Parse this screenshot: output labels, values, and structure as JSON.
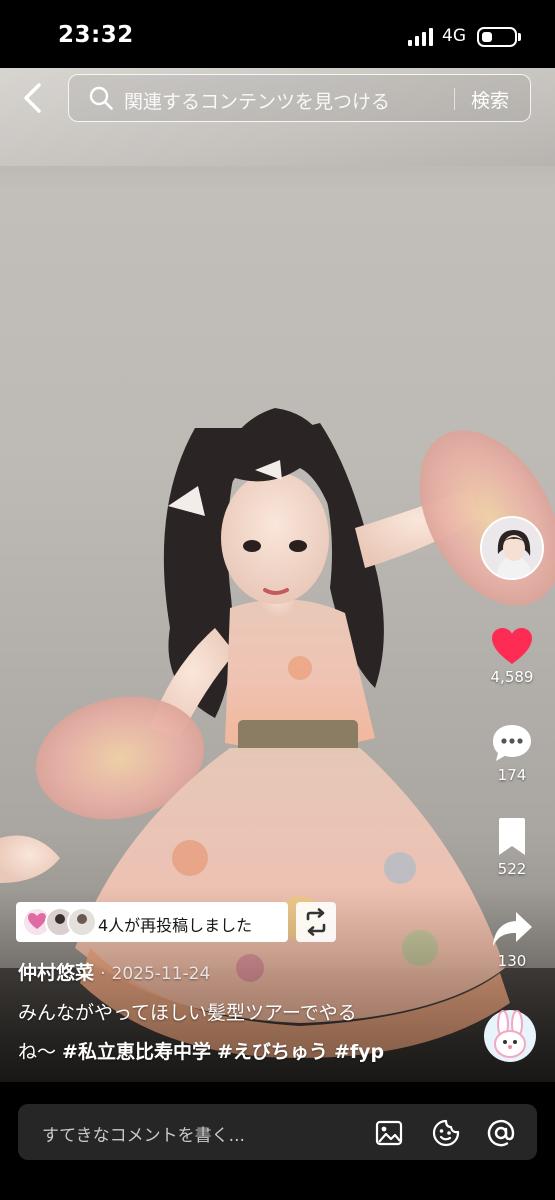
{
  "status_bar": {
    "time": "23:32",
    "network": "4G"
  },
  "search": {
    "placeholder": "関連するコンテンツを見つける",
    "button_label": "検索"
  },
  "actions": {
    "likes": "4,589",
    "comments": "174",
    "saves": "522",
    "shares": "130",
    "colors": {
      "like": "#fe2c55"
    }
  },
  "repost": {
    "text": "4人が再投稿しました"
  },
  "post": {
    "author": "仲村悠菜",
    "date_separator": "·",
    "date": "2025-11-24",
    "caption_line1": "みんながやってほしい髪型ツアーでやる",
    "caption_line2_text": "ね〜 ",
    "hashtags": [
      "#私立恵比寿中学",
      "#えびちゅう",
      "#fyp"
    ]
  },
  "comment": {
    "placeholder": "すてきなコメントを書く..."
  }
}
